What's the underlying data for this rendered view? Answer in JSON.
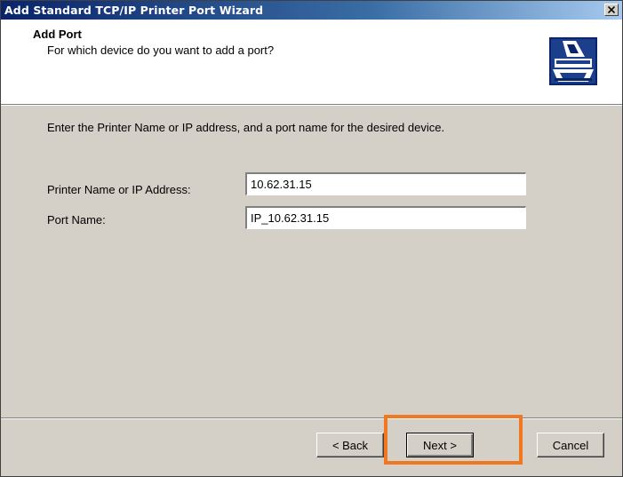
{
  "window": {
    "title": "Add Standard TCP/IP Printer Port Wizard",
    "close_glyph": "✕"
  },
  "header": {
    "title": "Add Port",
    "subtitle": "For which device do you want to add a port?",
    "icon": "printer-port-icon"
  },
  "body": {
    "intro": "Enter the Printer Name or IP address, and a port name for the desired device.",
    "fields": [
      {
        "label": "Printer Name or IP Address:",
        "value": "10.62.31.15"
      },
      {
        "label": "Port Name:",
        "value": "IP_10.62.31.15"
      }
    ]
  },
  "buttons": {
    "back": "< Back",
    "next": "Next >",
    "cancel": "Cancel"
  },
  "colors": {
    "highlight": "#f07820",
    "titlebar_start": "#0a246a",
    "titlebar_end": "#a6caf0",
    "dialog_face": "#d4d0c8"
  }
}
